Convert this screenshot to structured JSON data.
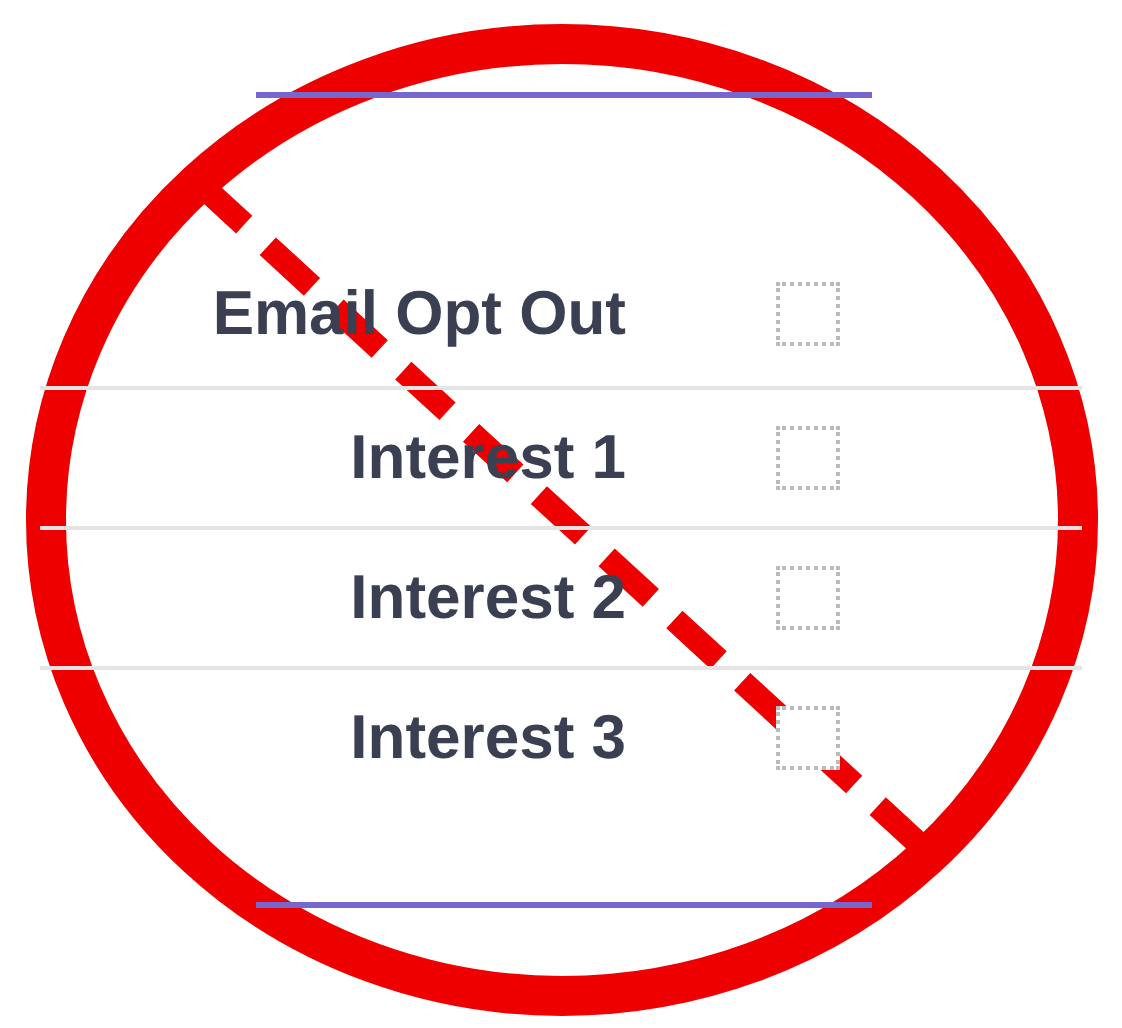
{
  "fields": [
    {
      "label": "Email Opt Out",
      "checked": false
    },
    {
      "label": "Interest 1",
      "checked": false
    },
    {
      "label": "Interest 2",
      "checked": false
    },
    {
      "label": "Interest 3",
      "checked": false
    }
  ]
}
